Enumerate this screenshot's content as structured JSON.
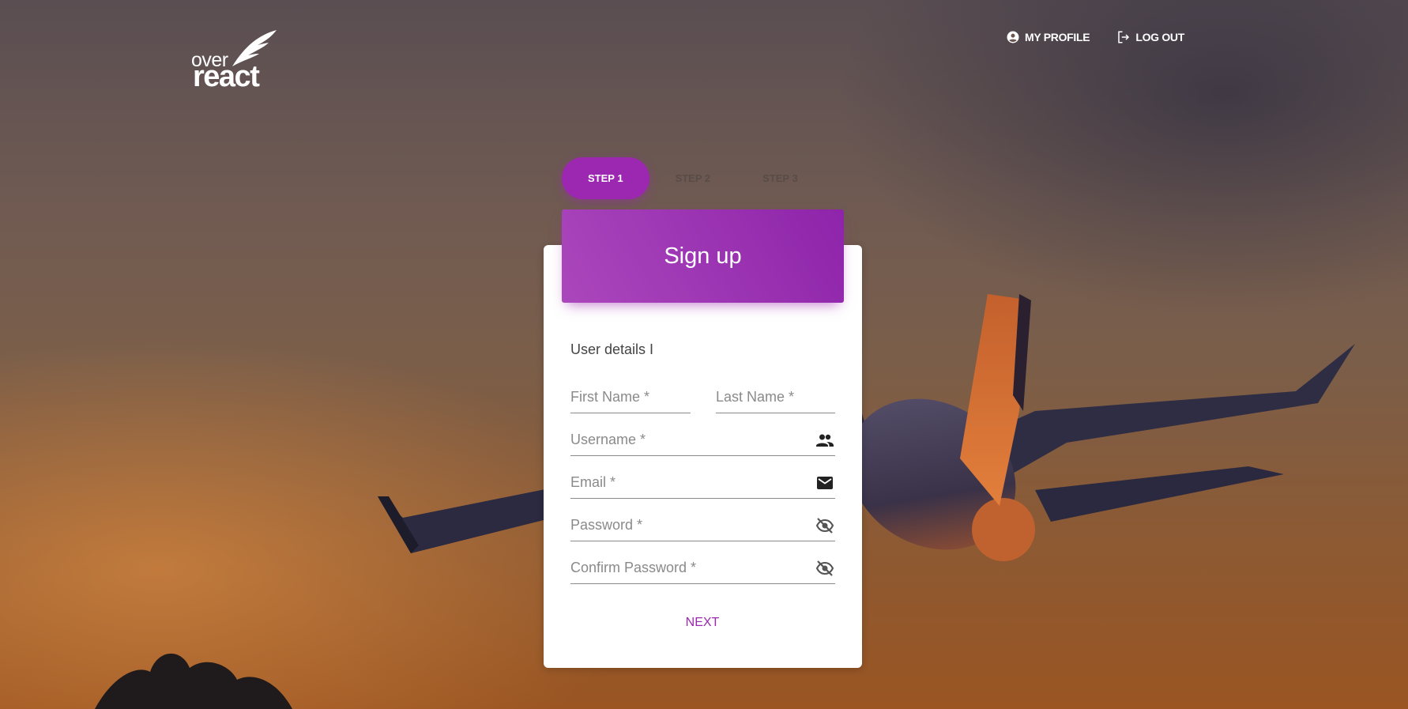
{
  "header": {
    "logo_top": "over",
    "logo_bottom": "react",
    "nav": [
      {
        "label": "MY PROFILE",
        "icon": "account-circle-icon"
      },
      {
        "label": "LOG OUT",
        "icon": "logout-icon"
      }
    ]
  },
  "stepper": {
    "steps": [
      "STEP 1",
      "STEP 2",
      "STEP 3"
    ],
    "active_index": 0
  },
  "card": {
    "title": "Sign up",
    "section": "User details I",
    "fields": {
      "first_name": {
        "placeholder": "First Name *",
        "value": ""
      },
      "last_name": {
        "placeholder": "Last Name *",
        "value": ""
      },
      "username": {
        "placeholder": "Username *",
        "value": "",
        "icon": "people-icon"
      },
      "email": {
        "placeholder": "Email *",
        "value": "",
        "icon": "mail-icon"
      },
      "password": {
        "placeholder": "Password *",
        "value": "",
        "icon": "visibility-off-icon"
      },
      "confirm_password": {
        "placeholder": "Confirm Password *",
        "value": "",
        "icon": "visibility-off-icon"
      }
    },
    "next_label": "NEXT"
  },
  "colors": {
    "accent": "#9c27b0",
    "header_gradient_start": "#ab47bc",
    "header_gradient_end": "#8e24aa"
  }
}
